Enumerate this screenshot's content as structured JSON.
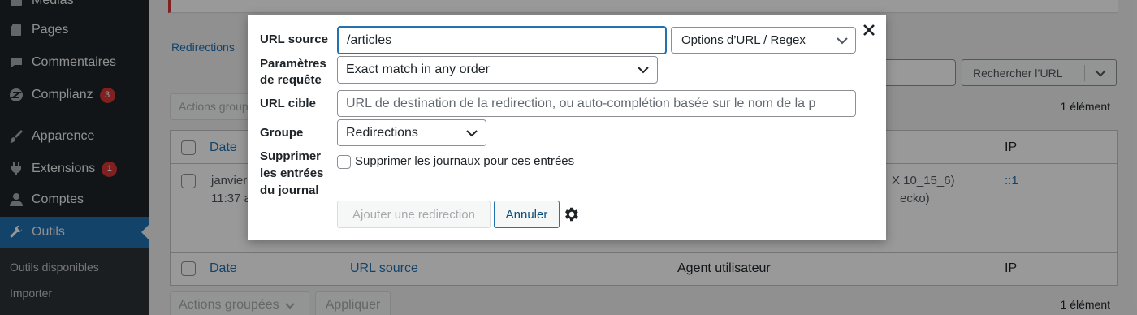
{
  "sidebar": {
    "items": [
      {
        "label": "Médias",
        "icon": "media-icon"
      },
      {
        "label": "Pages",
        "icon": "pages-icon"
      },
      {
        "label": "Commentaires",
        "icon": "comments-icon"
      },
      {
        "label": "Complianz",
        "icon": "complianz-icon",
        "badge": "3"
      },
      {
        "label": "Apparence",
        "icon": "brush-icon"
      },
      {
        "label": "Extensions",
        "icon": "plugin-icon",
        "badge": "1"
      },
      {
        "label": "Comptes",
        "icon": "user-icon"
      },
      {
        "label": "Outils",
        "icon": "wrench-icon",
        "active": true
      }
    ],
    "submenu": [
      "Outils disponibles",
      "Importer"
    ]
  },
  "page": {
    "subnav": "Redirections",
    "search_button": "Rechercher l’URL",
    "bulk_actions": "Actions groupées",
    "apply": "Appliquer",
    "count": "1 élément"
  },
  "table": {
    "headers": {
      "date": "Date",
      "url_source": "URL source",
      "agent": "Agent utilisateur",
      "ip": "IP"
    },
    "row": {
      "date_line1": "janvier",
      "date_line2": "11:37 a",
      "agent_line1": "X 10_15_6)",
      "agent_line2": "ecko)",
      "ip": "::1"
    }
  },
  "modal": {
    "labels": {
      "url_source": "URL source",
      "params_line1": "Paramètres",
      "params_line2": "de requête",
      "target": "URL cible",
      "group": "Groupe",
      "delete_line1": "Supprimer",
      "delete_line2": "les entrées",
      "delete_line3": "du journal"
    },
    "url_source_value": "/articles",
    "url_options_button": "Options d’URL / Regex",
    "query_params_value": "Exact match in any order",
    "target_placeholder": "URL de destination de la redirection, ou auto-complétion basée sur le nom de la p",
    "group_value": "Redirections",
    "delete_logs_label": "Supprimer les journaux pour ces entrées",
    "delete_logs_checked": false,
    "add_button": "Ajouter une redirection",
    "cancel_button": "Annuler"
  },
  "colors": {
    "sidebar_bg": "#1d2327",
    "active_bg": "#2271b1",
    "link": "#2271b1",
    "badge": "#d63638"
  }
}
